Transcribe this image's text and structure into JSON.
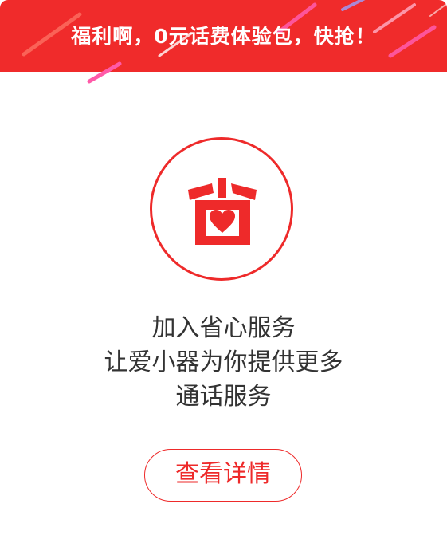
{
  "banner": {
    "title": "福利啊，0元话费体验包，快抢！",
    "background_color": "#f02b2b"
  },
  "logo": {
    "icon": "house-heart-icon",
    "color": "#ee2a2a"
  },
  "description": {
    "lines": [
      "加入省心服务",
      "让爱小器为你提供更多",
      "通话服务"
    ]
  },
  "detail_button": {
    "label": "查看详情",
    "color": "#ee2a2a"
  }
}
